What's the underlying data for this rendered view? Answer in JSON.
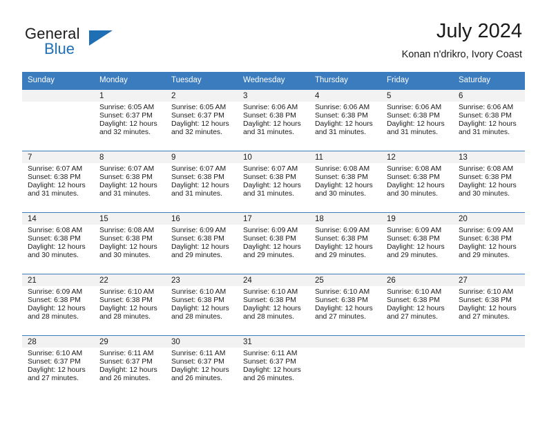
{
  "brand": {
    "word_one": "General",
    "word_two": "Blue",
    "logo_icon": "triangle-logo-icon",
    "accent_color": "#1f6fb5"
  },
  "header": {
    "title": "July 2024",
    "subtitle": "Konan n'drikro, Ivory Coast"
  },
  "calendar": {
    "header_bg": "#3b7cbf",
    "daynum_bg": "#f2f2f2",
    "weekday_headers": [
      "Sunday",
      "Monday",
      "Tuesday",
      "Wednesday",
      "Thursday",
      "Friday",
      "Saturday"
    ],
    "weeks": [
      [
        {
          "day": "",
          "sunrise": "",
          "sunset": "",
          "daylight_line1": "",
          "daylight_line2": "",
          "blank": true
        },
        {
          "day": "1",
          "sunrise": "Sunrise: 6:05 AM",
          "sunset": "Sunset: 6:37 PM",
          "daylight_line1": "Daylight: 12 hours",
          "daylight_line2": "and 32 minutes."
        },
        {
          "day": "2",
          "sunrise": "Sunrise: 6:05 AM",
          "sunset": "Sunset: 6:37 PM",
          "daylight_line1": "Daylight: 12 hours",
          "daylight_line2": "and 32 minutes."
        },
        {
          "day": "3",
          "sunrise": "Sunrise: 6:06 AM",
          "sunset": "Sunset: 6:38 PM",
          "daylight_line1": "Daylight: 12 hours",
          "daylight_line2": "and 31 minutes."
        },
        {
          "day": "4",
          "sunrise": "Sunrise: 6:06 AM",
          "sunset": "Sunset: 6:38 PM",
          "daylight_line1": "Daylight: 12 hours",
          "daylight_line2": "and 31 minutes."
        },
        {
          "day": "5",
          "sunrise": "Sunrise: 6:06 AM",
          "sunset": "Sunset: 6:38 PM",
          "daylight_line1": "Daylight: 12 hours",
          "daylight_line2": "and 31 minutes."
        },
        {
          "day": "6",
          "sunrise": "Sunrise: 6:06 AM",
          "sunset": "Sunset: 6:38 PM",
          "daylight_line1": "Daylight: 12 hours",
          "daylight_line2": "and 31 minutes."
        }
      ],
      [
        {
          "day": "7",
          "sunrise": "Sunrise: 6:07 AM",
          "sunset": "Sunset: 6:38 PM",
          "daylight_line1": "Daylight: 12 hours",
          "daylight_line2": "and 31 minutes."
        },
        {
          "day": "8",
          "sunrise": "Sunrise: 6:07 AM",
          "sunset": "Sunset: 6:38 PM",
          "daylight_line1": "Daylight: 12 hours",
          "daylight_line2": "and 31 minutes."
        },
        {
          "day": "9",
          "sunrise": "Sunrise: 6:07 AM",
          "sunset": "Sunset: 6:38 PM",
          "daylight_line1": "Daylight: 12 hours",
          "daylight_line2": "and 31 minutes."
        },
        {
          "day": "10",
          "sunrise": "Sunrise: 6:07 AM",
          "sunset": "Sunset: 6:38 PM",
          "daylight_line1": "Daylight: 12 hours",
          "daylight_line2": "and 31 minutes."
        },
        {
          "day": "11",
          "sunrise": "Sunrise: 6:08 AM",
          "sunset": "Sunset: 6:38 PM",
          "daylight_line1": "Daylight: 12 hours",
          "daylight_line2": "and 30 minutes."
        },
        {
          "day": "12",
          "sunrise": "Sunrise: 6:08 AM",
          "sunset": "Sunset: 6:38 PM",
          "daylight_line1": "Daylight: 12 hours",
          "daylight_line2": "and 30 minutes."
        },
        {
          "day": "13",
          "sunrise": "Sunrise: 6:08 AM",
          "sunset": "Sunset: 6:38 PM",
          "daylight_line1": "Daylight: 12 hours",
          "daylight_line2": "and 30 minutes."
        }
      ],
      [
        {
          "day": "14",
          "sunrise": "Sunrise: 6:08 AM",
          "sunset": "Sunset: 6:38 PM",
          "daylight_line1": "Daylight: 12 hours",
          "daylight_line2": "and 30 minutes."
        },
        {
          "day": "15",
          "sunrise": "Sunrise: 6:08 AM",
          "sunset": "Sunset: 6:38 PM",
          "daylight_line1": "Daylight: 12 hours",
          "daylight_line2": "and 30 minutes."
        },
        {
          "day": "16",
          "sunrise": "Sunrise: 6:09 AM",
          "sunset": "Sunset: 6:38 PM",
          "daylight_line1": "Daylight: 12 hours",
          "daylight_line2": "and 29 minutes."
        },
        {
          "day": "17",
          "sunrise": "Sunrise: 6:09 AM",
          "sunset": "Sunset: 6:38 PM",
          "daylight_line1": "Daylight: 12 hours",
          "daylight_line2": "and 29 minutes."
        },
        {
          "day": "18",
          "sunrise": "Sunrise: 6:09 AM",
          "sunset": "Sunset: 6:38 PM",
          "daylight_line1": "Daylight: 12 hours",
          "daylight_line2": "and 29 minutes."
        },
        {
          "day": "19",
          "sunrise": "Sunrise: 6:09 AM",
          "sunset": "Sunset: 6:38 PM",
          "daylight_line1": "Daylight: 12 hours",
          "daylight_line2": "and 29 minutes."
        },
        {
          "day": "20",
          "sunrise": "Sunrise: 6:09 AM",
          "sunset": "Sunset: 6:38 PM",
          "daylight_line1": "Daylight: 12 hours",
          "daylight_line2": "and 29 minutes."
        }
      ],
      [
        {
          "day": "21",
          "sunrise": "Sunrise: 6:09 AM",
          "sunset": "Sunset: 6:38 PM",
          "daylight_line1": "Daylight: 12 hours",
          "daylight_line2": "and 28 minutes."
        },
        {
          "day": "22",
          "sunrise": "Sunrise: 6:10 AM",
          "sunset": "Sunset: 6:38 PM",
          "daylight_line1": "Daylight: 12 hours",
          "daylight_line2": "and 28 minutes."
        },
        {
          "day": "23",
          "sunrise": "Sunrise: 6:10 AM",
          "sunset": "Sunset: 6:38 PM",
          "daylight_line1": "Daylight: 12 hours",
          "daylight_line2": "and 28 minutes."
        },
        {
          "day": "24",
          "sunrise": "Sunrise: 6:10 AM",
          "sunset": "Sunset: 6:38 PM",
          "daylight_line1": "Daylight: 12 hours",
          "daylight_line2": "and 28 minutes."
        },
        {
          "day": "25",
          "sunrise": "Sunrise: 6:10 AM",
          "sunset": "Sunset: 6:38 PM",
          "daylight_line1": "Daylight: 12 hours",
          "daylight_line2": "and 27 minutes."
        },
        {
          "day": "26",
          "sunrise": "Sunrise: 6:10 AM",
          "sunset": "Sunset: 6:38 PM",
          "daylight_line1": "Daylight: 12 hours",
          "daylight_line2": "and 27 minutes."
        },
        {
          "day": "27",
          "sunrise": "Sunrise: 6:10 AM",
          "sunset": "Sunset: 6:38 PM",
          "daylight_line1": "Daylight: 12 hours",
          "daylight_line2": "and 27 minutes."
        }
      ],
      [
        {
          "day": "28",
          "sunrise": "Sunrise: 6:10 AM",
          "sunset": "Sunset: 6:37 PM",
          "daylight_line1": "Daylight: 12 hours",
          "daylight_line2": "and 27 minutes."
        },
        {
          "day": "29",
          "sunrise": "Sunrise: 6:11 AM",
          "sunset": "Sunset: 6:37 PM",
          "daylight_line1": "Daylight: 12 hours",
          "daylight_line2": "and 26 minutes."
        },
        {
          "day": "30",
          "sunrise": "Sunrise: 6:11 AM",
          "sunset": "Sunset: 6:37 PM",
          "daylight_line1": "Daylight: 12 hours",
          "daylight_line2": "and 26 minutes."
        },
        {
          "day": "31",
          "sunrise": "Sunrise: 6:11 AM",
          "sunset": "Sunset: 6:37 PM",
          "daylight_line1": "Daylight: 12 hours",
          "daylight_line2": "and 26 minutes."
        },
        {
          "day": "",
          "sunrise": "",
          "sunset": "",
          "daylight_line1": "",
          "daylight_line2": "",
          "blank": true
        },
        {
          "day": "",
          "sunrise": "",
          "sunset": "",
          "daylight_line1": "",
          "daylight_line2": "",
          "blank": true
        },
        {
          "day": "",
          "sunrise": "",
          "sunset": "",
          "daylight_line1": "",
          "daylight_line2": "",
          "blank": true
        }
      ]
    ]
  }
}
